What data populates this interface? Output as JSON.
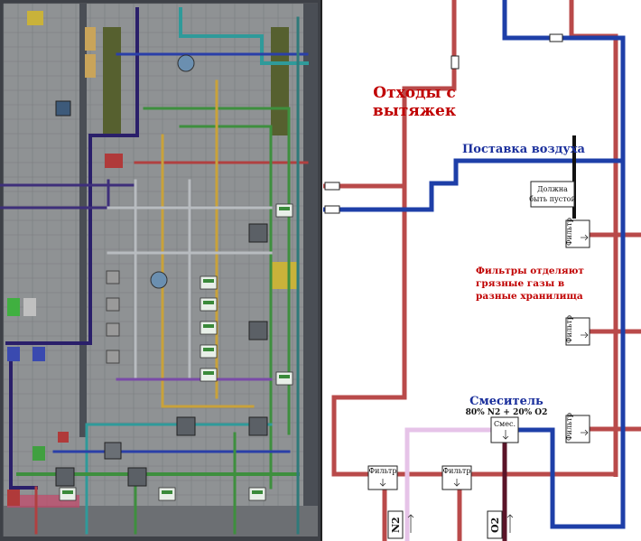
{
  "left_panel": {
    "caption": "game screenshot of station atmospherics room (pipes, vents, canisters)",
    "colors": {
      "floor": "#8f9294",
      "floor_grid": "#7a7d80",
      "wall": "#3e4147",
      "pipe_red": "#b04040",
      "pipe_blue": "#2a3fa8",
      "pipe_green": "#3e8f3e",
      "pipe_teal": "#2f9a9a",
      "pipe_yellow": "#c9a23a",
      "pipe_gray": "#b8bcc0",
      "pipe_purple": "#2a1f6a"
    }
  },
  "labels": {
    "waste": [
      "Отходы с",
      "вытяжек"
    ],
    "air_supply": "Поставка воздуха",
    "must_be_empty": [
      "Должна",
      "быть пустой"
    ],
    "filters_note": [
      "Фильтры отделяют",
      "грязные газы в",
      "разные хранилища"
    ],
    "mixer_title": "Смеситель",
    "mixer_ratio": "80% N2 + 20% O2",
    "mixer_box": "Смес.",
    "filter_box": "Фильтр",
    "n2": "N2",
    "o2": "O2"
  },
  "colors": {
    "red": "#b94a4a",
    "blue": "#1e3fa8",
    "black": "#111111",
    "pink": "#e6c3e8",
    "maroon": "#5a1428",
    "label_red": "#c00000",
    "label_blue": "#1a2f9c"
  }
}
